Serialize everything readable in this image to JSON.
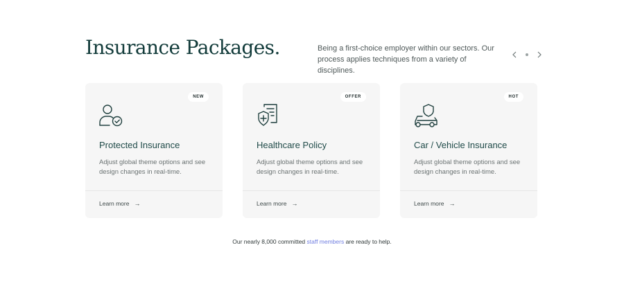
{
  "section": {
    "title": "Insurance Packages.",
    "intro": "Being a first-choice employer within our sectors. Our process applies techniques from a variety of disciplines."
  },
  "carousel": {
    "prev_icon": "chevron-left-icon",
    "next_icon": "chevron-right-icon",
    "prev_glyph": "‹",
    "next_glyph": "›"
  },
  "cards": [
    {
      "badge": "NEW",
      "icon": "person-check-icon",
      "title": "Protected Insurance",
      "description": "Adjust global theme options and see design changes in real-time.",
      "link": "Learn more",
      "arrow": "→"
    },
    {
      "badge": "OFFER",
      "icon": "medical-document-icon",
      "title": "Healthcare Policy",
      "description": "Adjust global theme options and see design changes in real-time.",
      "link": "Learn more",
      "arrow": "→"
    },
    {
      "badge": "HOT",
      "icon": "car-shield-icon",
      "title": "Car / Vehicle Insurance",
      "description": "Adjust global theme options and see design changes in real-time.",
      "link": "Learn more",
      "arrow": "→"
    }
  ],
  "footnote": {
    "before": "Our nearly 8,000 committed ",
    "link": "staff members",
    "after": " are ready to help."
  },
  "colors": {
    "title": "#123b3a",
    "card_background": "#f6f6f6",
    "icon_stroke": "#1f3f3e",
    "link_accent": "#6f7de0"
  }
}
